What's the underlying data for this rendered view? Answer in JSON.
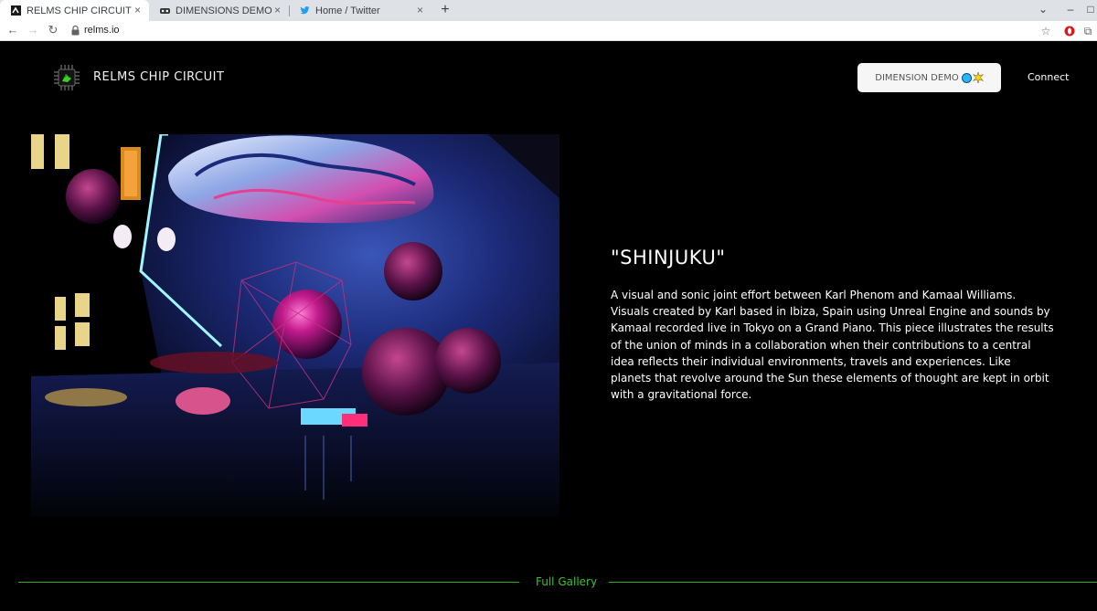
{
  "browser": {
    "tabs": [
      {
        "label": "RELMS CHIP CIRCUIT",
        "icon": "relms-favicon",
        "active": true
      },
      {
        "label": "DIMENSIONS DEMO",
        "icon": "vr-headset-icon",
        "active": false
      },
      {
        "label": "Home / Twitter",
        "icon": "twitter-icon",
        "active": false
      }
    ],
    "url": "relms.io"
  },
  "header": {
    "brand": "RELMS CHIP CIRCUIT",
    "demo_button": "DIMENSION DEMO",
    "connect": "Connect"
  },
  "artwork": {
    "title": "\"SHINJUKU\"",
    "description": "A visual and sonic joint effort between Karl Phenom and Kamaal Williams. Visuals created by Karl based in Ibiza, Spain using Unreal Engine and sounds by Kamaal recorded live in Tokyo on a Grand Piano. This piece illustrates the results of the union of minds in a collaboration when their contributions to a central idea reflects their individual environments, travels and experiences. Like planets that revolve around the Sun these elements of thought are kept in orbit with a gravitational force."
  },
  "footer": {
    "gallery_link": "Full Gallery"
  },
  "colors": {
    "accent_green": "#36c62a",
    "background": "#000000"
  }
}
